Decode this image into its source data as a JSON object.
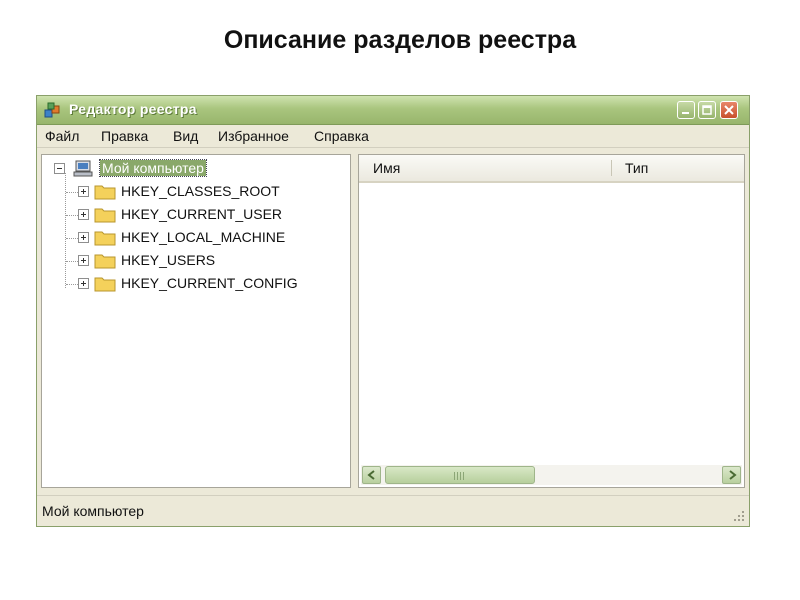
{
  "slide": {
    "title": "Описание разделов реестра"
  },
  "window": {
    "title": "Редактор реестра"
  },
  "menu": [
    "Файл",
    "Правка",
    "Вид",
    "Избранное",
    "Справка"
  ],
  "tree": {
    "root": "Мой компьютер",
    "items": [
      "HKEY_CLASSES_ROOT",
      "HKEY_CURRENT_USER",
      "HKEY_LOCAL_MACHINE",
      "HKEY_USERS",
      "HKEY_CURRENT_CONFIG"
    ]
  },
  "list": {
    "columns": [
      "Имя",
      "Тип"
    ]
  },
  "status": {
    "text": "Мой компьютер"
  },
  "colors": {
    "titlebar": "#a9c57e",
    "selection": "#8aa86a",
    "folder": "#f4d15b",
    "close_button": "#c8502c"
  }
}
